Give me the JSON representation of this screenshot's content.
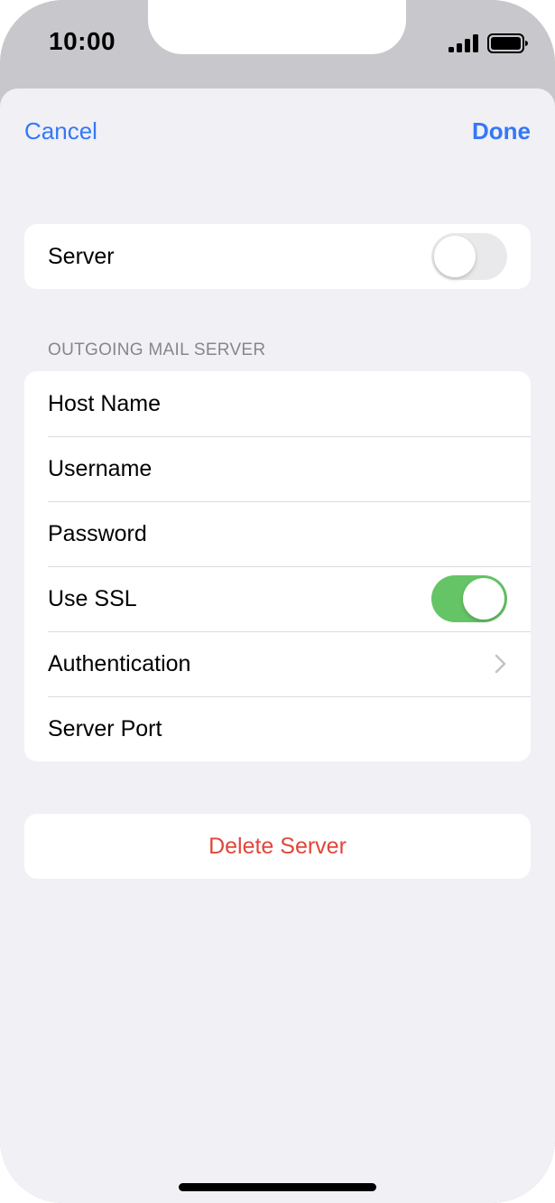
{
  "status_bar": {
    "time": "10:00",
    "signal_icon": "cellular-signal-icon",
    "battery_icon": "battery-icon"
  },
  "nav": {
    "cancel_label": "Cancel",
    "done_label": "Done"
  },
  "server_card": {
    "label": "Server",
    "toggle_on": false
  },
  "outgoing": {
    "header": "OUTGOING MAIL SERVER",
    "rows": [
      {
        "label": "Host Name"
      },
      {
        "label": "Username"
      },
      {
        "label": "Password"
      },
      {
        "label": "Use SSL",
        "toggle_on": true
      },
      {
        "label": "Authentication",
        "icon": "chevron-right-icon"
      },
      {
        "label": "Server Port"
      }
    ]
  },
  "delete": {
    "label": "Delete Server"
  },
  "colors": {
    "accent": "#3478f6",
    "destructive": "#e0473b",
    "toggle_on": "#65c466",
    "toggle_off": "#e9e9eb",
    "background": "#f0f0f5"
  }
}
